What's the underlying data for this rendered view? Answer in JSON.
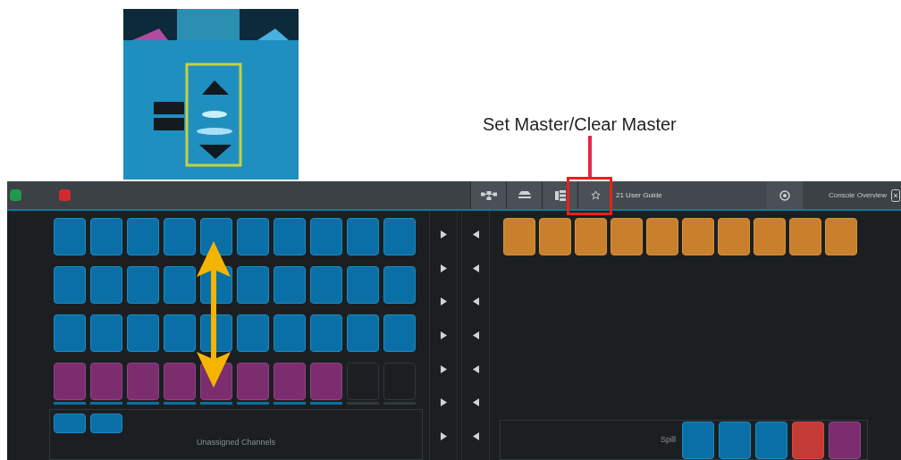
{
  "annotation": {
    "text": "Set Master/Clear Master"
  },
  "top_bar": {
    "left_buttons": [
      {
        "color": "#1f9a4a"
      },
      {
        "color": "#d8282f"
      }
    ],
    "tools": [
      {
        "kind": "network"
      },
      {
        "kind": "did"
      },
      {
        "kind": "snap"
      },
      {
        "kind": "star"
      }
    ],
    "show_title": "21 User Guide",
    "console_overview": "Console Overview"
  },
  "fader_rows": [
    {
      "tiles": [
        {
          "kind": "input"
        },
        {
          "kind": "input"
        },
        {
          "kind": "input"
        },
        {
          "kind": "input"
        },
        {
          "kind": "input"
        },
        {
          "kind": "input"
        },
        {
          "kind": "input"
        },
        {
          "kind": "input"
        },
        {
          "kind": "input"
        },
        {
          "kind": "input"
        }
      ]
    },
    {
      "tiles": [
        {
          "kind": "input"
        },
        {
          "kind": "input"
        },
        {
          "kind": "input"
        },
        {
          "kind": "input"
        },
        {
          "kind": "input"
        },
        {
          "kind": "input"
        },
        {
          "kind": "input"
        },
        {
          "kind": "input"
        },
        {
          "kind": "input"
        },
        {
          "kind": "input"
        }
      ]
    },
    {
      "tiles": [
        {
          "kind": "input"
        },
        {
          "kind": "input"
        },
        {
          "kind": "input"
        },
        {
          "kind": "input"
        },
        {
          "kind": "input"
        },
        {
          "kind": "input"
        },
        {
          "kind": "input"
        },
        {
          "kind": "input"
        },
        {
          "kind": "input"
        },
        {
          "kind": "input"
        }
      ]
    },
    {
      "tiles": [
        {
          "kind": "aux"
        },
        {
          "kind": "aux"
        },
        {
          "kind": "aux"
        },
        {
          "kind": "aux"
        },
        {
          "kind": "aux"
        },
        {
          "kind": "aux"
        },
        {
          "kind": "aux"
        },
        {
          "kind": "aux"
        },
        {
          "kind": "empty"
        },
        {
          "kind": "empty"
        }
      ]
    }
  ],
  "unassigned": {
    "title": "Unassigned Channels",
    "tiles": [
      {
        "kind": "input"
      },
      {
        "kind": "input"
      }
    ]
  },
  "fx_row": [
    {
      "kind": "fx"
    },
    {
      "kind": "fx"
    },
    {
      "kind": "fx"
    },
    {
      "kind": "fx"
    },
    {
      "kind": "fx"
    },
    {
      "kind": "fx"
    },
    {
      "kind": "fx"
    },
    {
      "kind": "fx"
    },
    {
      "kind": "fx"
    },
    {
      "kind": "fx"
    }
  ],
  "spill": {
    "title": "Spill",
    "tiles": [
      {
        "kind": "input"
      },
      {
        "kind": "input"
      },
      {
        "kind": "input"
      },
      {
        "kind": "group"
      },
      {
        "kind": "aux"
      }
    ]
  }
}
